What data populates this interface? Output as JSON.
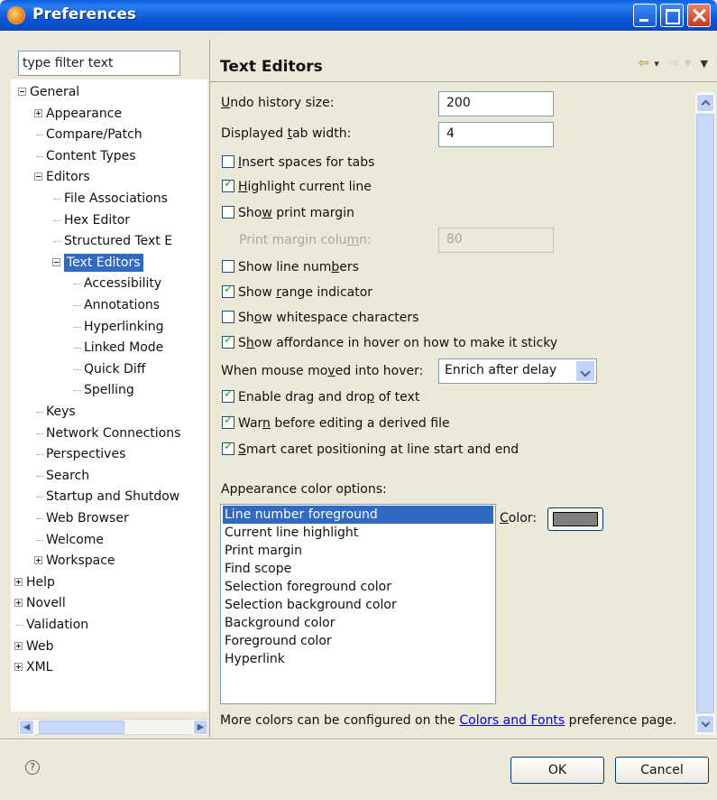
{
  "window": {
    "title": "Preferences"
  },
  "left_pane": {
    "filter_placeholder": "type filter text",
    "tree": [
      {
        "label": "General",
        "expander": "minus"
      },
      {
        "label": "Appearance",
        "expander": "plus"
      },
      {
        "label": "Compare/Patch"
      },
      {
        "label": "Content Types"
      },
      {
        "label": "Editors",
        "expander": "minus"
      },
      {
        "label": "File Associations"
      },
      {
        "label": "Hex Editor"
      },
      {
        "label": "Structured Text E"
      },
      {
        "label": "Text Editors",
        "expander": "minus",
        "selected": true
      },
      {
        "label": "Accessibility"
      },
      {
        "label": "Annotations"
      },
      {
        "label": "Hyperlinking"
      },
      {
        "label": "Linked Mode"
      },
      {
        "label": "Quick Diff"
      },
      {
        "label": "Spelling"
      },
      {
        "label": "Keys"
      },
      {
        "label": "Network Connections"
      },
      {
        "label": "Perspectives"
      },
      {
        "label": "Search"
      },
      {
        "label": "Startup and Shutdow"
      },
      {
        "label": "Web Browser"
      },
      {
        "label": "Welcome"
      },
      {
        "label": "Workspace",
        "expander": "plus"
      },
      {
        "label": "Help",
        "expander": "plus"
      },
      {
        "label": "Novell",
        "expander": "plus"
      },
      {
        "label": "Validation"
      },
      {
        "label": "Web",
        "expander": "plus"
      },
      {
        "label": "XML",
        "expander": "plus"
      }
    ]
  },
  "page": {
    "title": "Text Editors",
    "undo_history": {
      "label_pre": "",
      "label_u": "U",
      "label_post": "ndo history size:",
      "value": "200"
    },
    "tab_width": {
      "label_pre": "Displayed ",
      "label_u": "t",
      "label_post": "ab width:",
      "value": "4"
    },
    "print_margin_column": {
      "label_pre": "Print margin colu",
      "label_u": "m",
      "label_post": "n:",
      "value": "80"
    },
    "checkboxes": [
      {
        "pre": "",
        "u": "I",
        "post": "nsert spaces for tabs",
        "checked": false
      },
      {
        "pre": "",
        "u": "H",
        "post": "ighlight current line",
        "checked": true
      },
      {
        "pre": "Sho",
        "u": "w",
        "post": " print margin",
        "checked": false
      },
      {
        "pre": "Show line num",
        "u": "b",
        "post": "ers",
        "checked": false
      },
      {
        "pre": "Show ",
        "u": "r",
        "post": "ange indicator",
        "checked": true
      },
      {
        "pre": "Sh",
        "u": "o",
        "post": "w whitespace characters",
        "checked": false
      },
      {
        "pre": "S",
        "u": "h",
        "post": "ow affordance in hover on how to make it sticky",
        "checked": true
      },
      {
        "pre": "Enable drag and dro",
        "u": "p",
        "post": " of text",
        "checked": true
      },
      {
        "pre": "War",
        "u": "n",
        "post": " before editing a derived file",
        "checked": true
      },
      {
        "pre": "",
        "u": "S",
        "post": "mart caret positioning at line start and end",
        "checked": true
      }
    ],
    "hover": {
      "label_pre": "When mouse mo",
      "label_u": "v",
      "label_post": "ed into hover:",
      "selected": "Enrich after delay"
    },
    "appearance_color_label": "Appearance color options:",
    "color_options": [
      "Line number foreground",
      "Current line highlight",
      "Print margin",
      "Find scope",
      "Selection foreground color",
      "Selection background color",
      "Background color",
      "Foreground color",
      "Hyperlink"
    ],
    "color_label_pre": "",
    "color_label_u": "C",
    "color_label_post": "olor:",
    "swatch_color": "#808080",
    "more_colors_pre": "More colors can be configured on the ",
    "more_colors_link": "Colors and Fonts",
    "more_colors_post": " preference page."
  },
  "footer": {
    "ok": "OK",
    "cancel": "Cancel",
    "help_icon": "question-icon"
  }
}
